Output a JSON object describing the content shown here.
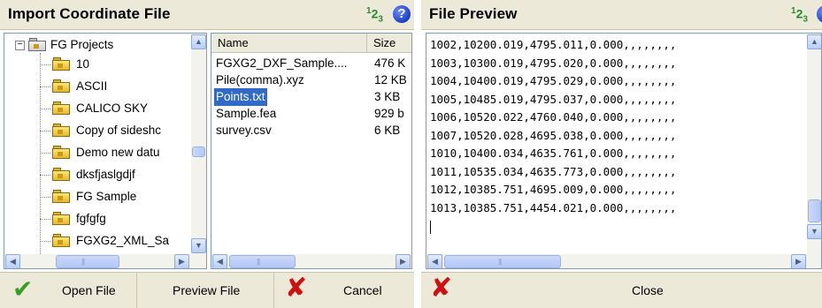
{
  "import_dialog": {
    "title": "Import Coordinate File",
    "units_main": "1",
    "units_sub": "2",
    "units_sup": "3",
    "help_glyph": "?",
    "tree": {
      "root": {
        "label": "FG Projects",
        "expander": "−",
        "icon": "folder-open-icon"
      },
      "folders": [
        "10",
        "ASCII",
        "CALICO SKY",
        "Copy of sideshc",
        "Demo new datu",
        "dksfjaslgdjf",
        "FG Sample",
        "fgfgfg",
        "FGXG2_XML_Sa"
      ]
    },
    "file_list": {
      "columns": [
        "Name",
        "Size"
      ],
      "rows": [
        {
          "name": "FGXG2_DXF_Sample....",
          "size": "476 K"
        },
        {
          "name": "Pile(comma).xyz",
          "size": "12 KB"
        },
        {
          "name": "Points.txt",
          "size": "3 KB",
          "selected": true
        },
        {
          "name": "Sample.fea",
          "size": "929 b"
        },
        {
          "name": "survey.csv",
          "size": "6 KB"
        }
      ]
    },
    "buttons": {
      "open": "Open File",
      "preview": "Preview File",
      "cancel": "Cancel"
    }
  },
  "preview_dialog": {
    "title": "File Preview",
    "units_main": "1",
    "units_sub": "2",
    "units_sup": "3",
    "lines": [
      "1002,10200.019,4795.011,0.000,,,,,,,,",
      "1003,10300.019,4795.020,0.000,,,,,,,,",
      "1004,10400.019,4795.029,0.000,,,,,,,,",
      "1005,10485.019,4795.037,0.000,,,,,,,,",
      "1006,10520.022,4760.040,0.000,,,,,,,,",
      "1007,10520.028,4695.038,0.000,,,,,,,,",
      "1010,10400.034,4635.761,0.000,,,,,,,,",
      "1011,10535.034,4635.773,0.000,,,,,,,,",
      "1012,10385.751,4695.009,0.000,,,,,,,,",
      "1013,10385.751,4454.021,0.000,,,,,,,,"
    ],
    "buttons": {
      "close": "Close"
    }
  },
  "colors": {
    "selection": "#316ac5",
    "check": "#33a020",
    "cancel_x": "#d01010",
    "units_green": "#2a8a2a"
  }
}
